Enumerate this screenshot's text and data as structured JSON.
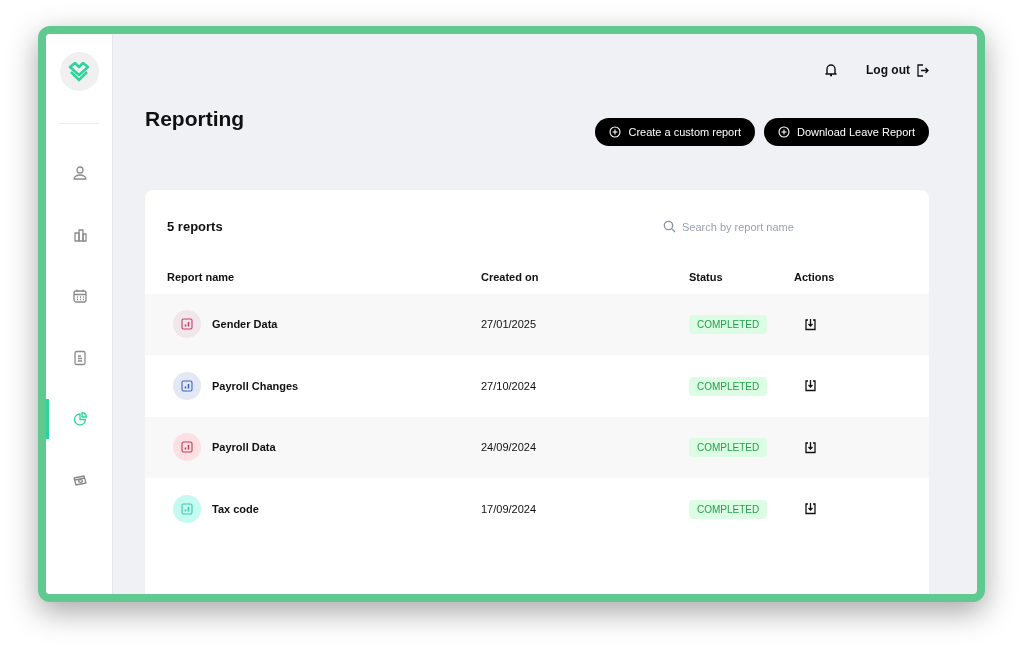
{
  "sidebar": {
    "items": [
      {
        "kind": "person",
        "selected": false
      },
      {
        "kind": "buildings",
        "selected": false
      },
      {
        "kind": "calendar",
        "selected": false
      },
      {
        "kind": "document",
        "selected": false
      },
      {
        "kind": "pie",
        "selected": true
      },
      {
        "kind": "money",
        "selected": false
      }
    ]
  },
  "header": {
    "logout": "Log out"
  },
  "page": {
    "title": "Reporting",
    "buttons": [
      "Create a custom report",
      "Download Leave Report"
    ]
  },
  "card": {
    "count": "5 reports",
    "search": {
      "placeholder": "Search by report name"
    },
    "columns": [
      "Report name",
      "Created on",
      "Status",
      "Actions"
    ],
    "rows": [
      {
        "name": "Gender Data",
        "created": "27/01/2025",
        "status": "COMPLETED",
        "color": "#f1e6ea"
      },
      {
        "name": "Payroll Changes",
        "created": "27/10/2024",
        "status": "COMPLETED",
        "color": "#e4e8f2"
      },
      {
        "name": "Payroll Data",
        "created": "24/09/2024",
        "status": "COMPLETED",
        "color": "#fde0e4"
      },
      {
        "name": "Tax code",
        "created": "17/09/2024",
        "status": "COMPLETED",
        "color": "#c4faf0"
      }
    ]
  }
}
